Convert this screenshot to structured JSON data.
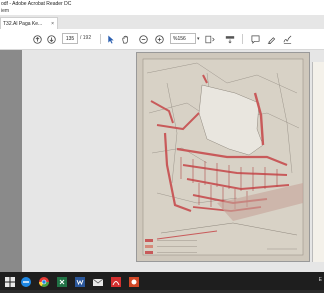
{
  "window": {
    "title": "odf - Adobe Acrobat Reader DC",
    "menu": "iem"
  },
  "tab": {
    "label": "T32.Al Paga Ke...",
    "close": "×"
  },
  "toolbar": {
    "page_current": "135",
    "page_total": "/ 192",
    "zoom": "%156"
  },
  "tray": {
    "text": "E"
  },
  "colors": {
    "accent": "#c0392b",
    "map_red": "#c85a5a"
  }
}
